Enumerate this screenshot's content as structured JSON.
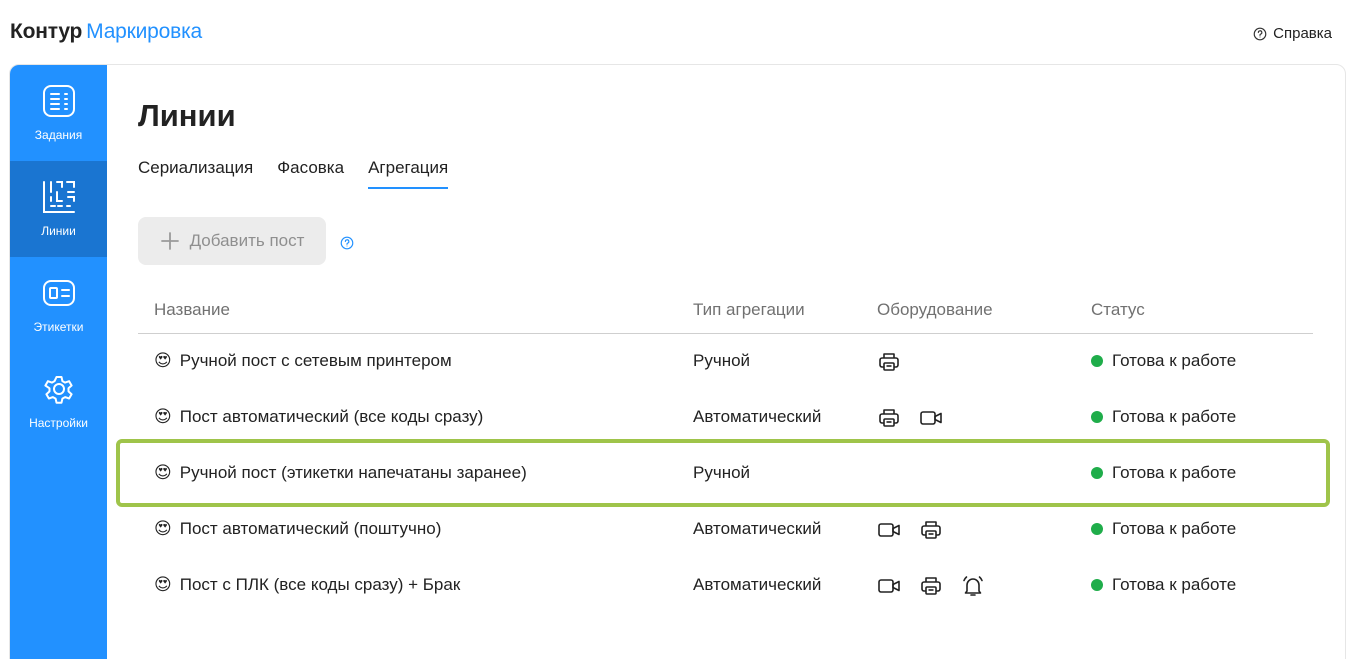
{
  "app": {
    "brand": "Контур",
    "product": "Маркировка",
    "help_label": "Справка"
  },
  "sidebar": {
    "items": [
      {
        "label": "Задания",
        "icon": "tasks-icon",
        "active": false
      },
      {
        "label": "Линии",
        "icon": "lines-icon",
        "active": true
      },
      {
        "label": "Этикетки",
        "icon": "labels-icon",
        "active": false
      },
      {
        "label": "Настройки",
        "icon": "settings-icon",
        "active": false
      }
    ]
  },
  "page": {
    "title": "Линии",
    "tabs": [
      {
        "label": "Сериализация",
        "active": false
      },
      {
        "label": "Фасовка",
        "active": false
      },
      {
        "label": "Агрегация",
        "active": true
      }
    ],
    "add_button_label": "Добавить пост"
  },
  "table": {
    "headers": [
      "Название",
      "Тип агрегации",
      "Оборудование",
      "Статус"
    ],
    "rows": [
      {
        "emoji": "😍",
        "name": "Ручной пост с сетевым принтером",
        "type": "Ручной",
        "equipment": [
          "printer-icon"
        ],
        "status": "Готова к работе"
      },
      {
        "emoji": "😍",
        "name": "Пост автоматический (все коды сразу)",
        "type": "Автоматический",
        "equipment": [
          "printer-icon",
          "camera-icon"
        ],
        "status": "Готова к работе"
      },
      {
        "emoji": "😍",
        "name": "Ручной пост (этикетки напечатаны заранее)",
        "type": "Ручной",
        "equipment": [],
        "status": "Готова к работе"
      },
      {
        "emoji": "😍",
        "name": "Пост автоматический (поштучно)",
        "type": "Автоматический",
        "equipment": [
          "camera-icon",
          "printer-icon"
        ],
        "status": "Готова к работе"
      },
      {
        "emoji": "😍",
        "name": "Пост с ПЛК (все коды сразу) + Брак",
        "type": "Автоматический",
        "equipment": [
          "camera-icon",
          "printer-icon",
          "bell-icon"
        ],
        "status": "Готова к работе"
      }
    ]
  },
  "colors": {
    "accent": "#2291ff",
    "sidebar_active": "#1a75d1",
    "status_ok": "#1fad4a",
    "highlight": "#9fc44a"
  }
}
